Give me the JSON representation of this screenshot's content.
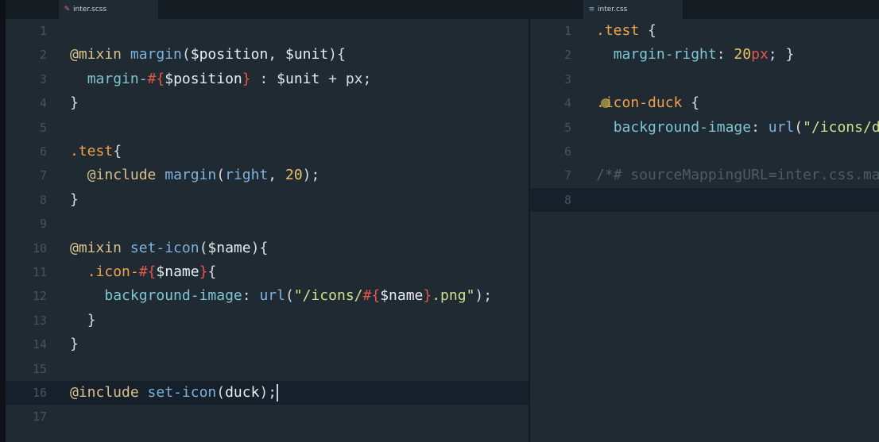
{
  "left": {
    "tab": {
      "icon": "sass-icon",
      "title": "inter.scss"
    },
    "lines": [
      {
        "n": "1",
        "tokens": []
      },
      {
        "n": "2",
        "tokens": [
          [
            "at",
            "@mixin"
          ],
          [
            "sp",
            " "
          ],
          [
            "fn",
            "margin"
          ],
          [
            "punc",
            "("
          ],
          [
            "var",
            "$position"
          ],
          [
            "punc",
            ", "
          ],
          [
            "var",
            "$unit"
          ],
          [
            "punc",
            "){"
          ]
        ]
      },
      {
        "n": "3",
        "tokens": [
          [
            "sp",
            "  "
          ],
          [
            "prop",
            "margin-"
          ],
          [
            "interp",
            "#{"
          ],
          [
            "var",
            "$position"
          ],
          [
            "interp",
            "}"
          ],
          [
            "punc",
            " : "
          ],
          [
            "var",
            "$unit"
          ],
          [
            "op",
            " + "
          ],
          [
            "punc",
            "px;"
          ]
        ]
      },
      {
        "n": "4",
        "tokens": [
          [
            "punc",
            "}"
          ]
        ]
      },
      {
        "n": "5",
        "tokens": []
      },
      {
        "n": "6",
        "tokens": [
          [
            "cls",
            ".test"
          ],
          [
            "punc",
            "{"
          ]
        ]
      },
      {
        "n": "7",
        "tokens": [
          [
            "sp",
            "  "
          ],
          [
            "at",
            "@include"
          ],
          [
            "sp",
            " "
          ],
          [
            "fn",
            "margin"
          ],
          [
            "punc",
            "("
          ],
          [
            "fn",
            "right"
          ],
          [
            "punc",
            ", "
          ],
          [
            "num",
            "20"
          ],
          [
            "punc",
            ");"
          ]
        ]
      },
      {
        "n": "8",
        "tokens": [
          [
            "punc",
            "}"
          ]
        ]
      },
      {
        "n": "9",
        "tokens": []
      },
      {
        "n": "10",
        "tokens": [
          [
            "at",
            "@mixin"
          ],
          [
            "sp",
            " "
          ],
          [
            "fn",
            "set-icon"
          ],
          [
            "punc",
            "("
          ],
          [
            "var",
            "$name"
          ],
          [
            "punc",
            "){"
          ]
        ]
      },
      {
        "n": "11",
        "tokens": [
          [
            "sp",
            "  "
          ],
          [
            "cls",
            ".icon-"
          ],
          [
            "interp",
            "#{"
          ],
          [
            "var",
            "$name"
          ],
          [
            "interp",
            "}"
          ],
          [
            "punc",
            "{"
          ]
        ]
      },
      {
        "n": "12",
        "tokens": [
          [
            "sp",
            "    "
          ],
          [
            "prop",
            "background-image"
          ],
          [
            "punc",
            ": "
          ],
          [
            "fn",
            "url"
          ],
          [
            "punc",
            "("
          ],
          [
            "str",
            "\"/icons/"
          ],
          [
            "interp",
            "#{"
          ],
          [
            "var",
            "$name"
          ],
          [
            "interp",
            "}"
          ],
          [
            "str",
            ".png\""
          ],
          [
            "punc",
            ");"
          ]
        ]
      },
      {
        "n": "13",
        "tokens": [
          [
            "sp",
            "  "
          ],
          [
            "punc",
            "}"
          ]
        ]
      },
      {
        "n": "14",
        "tokens": [
          [
            "punc",
            "}"
          ]
        ]
      },
      {
        "n": "15",
        "tokens": []
      },
      {
        "n": "16",
        "tokens": [
          [
            "at",
            "@include"
          ],
          [
            "sp",
            " "
          ],
          [
            "fn",
            "set-icon"
          ],
          [
            "punc",
            "("
          ],
          [
            "var",
            "duck"
          ],
          [
            "punc",
            ");"
          ]
        ],
        "current": true,
        "cursor": true
      },
      {
        "n": "17",
        "tokens": []
      }
    ]
  },
  "right": {
    "tab": {
      "icon": "css-icon",
      "title": "inter.css"
    },
    "lines": [
      {
        "n": "1",
        "tokens": [
          [
            "cls",
            ".test"
          ],
          [
            "punc",
            " {"
          ]
        ]
      },
      {
        "n": "2",
        "tokens": [
          [
            "sp",
            "  "
          ],
          [
            "prop",
            "margin-right"
          ],
          [
            "punc",
            ": "
          ],
          [
            "num",
            "20"
          ],
          [
            "unit",
            "px"
          ],
          [
            "punc",
            "; }"
          ]
        ]
      },
      {
        "n": "3",
        "tokens": []
      },
      {
        "n": "4",
        "tokens": [
          [
            "cls",
            ".icon-duck"
          ],
          [
            "punc",
            " {"
          ]
        ],
        "blob": true
      },
      {
        "n": "5",
        "tokens": [
          [
            "sp",
            "  "
          ],
          [
            "prop",
            "background-image"
          ],
          [
            "punc",
            ": "
          ],
          [
            "fn",
            "url"
          ],
          [
            "punc",
            "("
          ],
          [
            "str",
            "\"/icons/duck.png\""
          ],
          [
            "punc",
            "); }"
          ]
        ]
      },
      {
        "n": "6",
        "tokens": []
      },
      {
        "n": "7",
        "tokens": [
          [
            "cmt",
            "/*# sourceMappingURL=inter.css.map */"
          ]
        ]
      },
      {
        "n": "8",
        "tokens": [],
        "current": true
      }
    ]
  }
}
